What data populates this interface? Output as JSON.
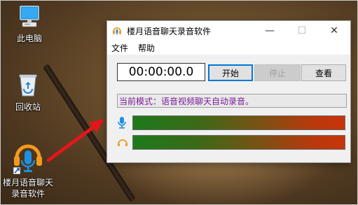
{
  "desktop": {
    "icons": [
      {
        "label": "此电脑"
      },
      {
        "label": "回收站"
      },
      {
        "label_line1": "楼月语音聊天",
        "label_line2": "录音软件"
      }
    ]
  },
  "window": {
    "title": "楼月语音聊天录音软件",
    "controls": {
      "minimize": "—",
      "maximize": "☐",
      "close": "✕"
    },
    "menu": [
      "文件",
      "帮助"
    ],
    "timer": "00:00:00.0",
    "buttons": {
      "start": "开始",
      "stop": "停止",
      "view": "查看"
    },
    "mode_text": "当前模式：语音视频聊天自动录音。",
    "meters": {
      "mic_icon": "microphone-icon",
      "speaker_icon": "headphones-icon"
    },
    "colors": {
      "accent": "#0078d7",
      "mode_text": "#7a1d96",
      "mic_icon": "#2196d8",
      "headphone_icon": "#f39a1e"
    }
  }
}
